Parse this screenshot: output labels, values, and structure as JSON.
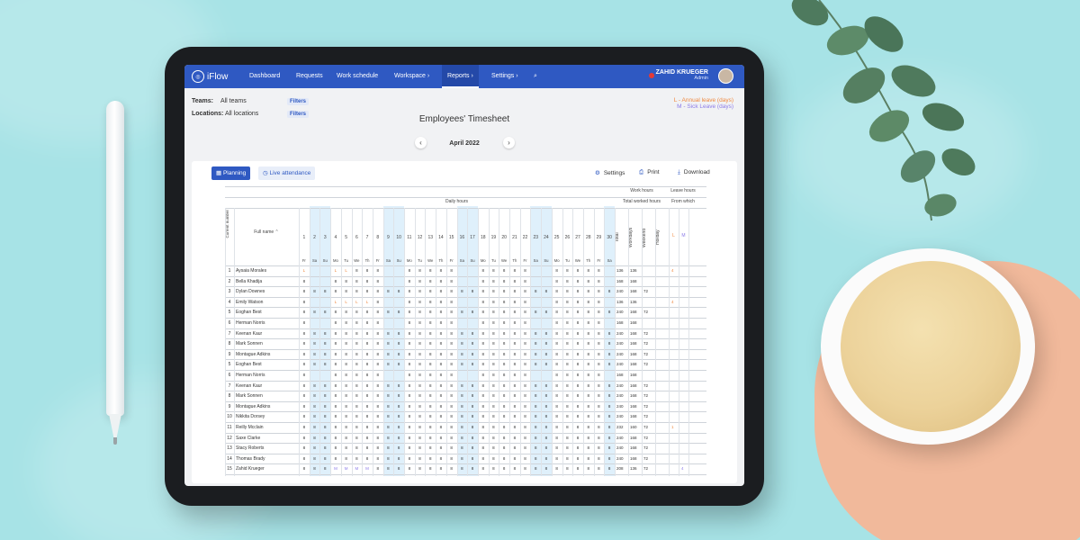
{
  "app": {
    "name": "iFlow",
    "nav": [
      "Dashboard",
      "Requests",
      "Work schedule",
      "Workspace",
      "Reports",
      "Settings"
    ],
    "nav_has_chevron": [
      false,
      false,
      false,
      true,
      true,
      true
    ],
    "active_nav": "Reports",
    "user_name": "ZAHID KRUEGER",
    "user_role": "Admin"
  },
  "filters": {
    "teams_label": "Teams:",
    "teams_value": "All teams",
    "locations_label": "Locations:",
    "locations_value": "All locations",
    "filters_button": "Filters"
  },
  "legend": {
    "annual": "L - Annual leave (days)",
    "sick": "M - Sick Leave (days)",
    "annual_color": "#f0883e",
    "sick_color": "#8c7be8"
  },
  "page_title": "Employees' Timesheet",
  "month": "April 2022",
  "tabs": {
    "planning": "Planning",
    "live": "Live attendance"
  },
  "tools": {
    "settings": "Settings",
    "print": "Print",
    "download": "Download"
  },
  "table": {
    "header_current_number": "Current number",
    "header_full_name": "Full name",
    "header_daily_hours": "Daily hours",
    "header_work_hours": "Work hours",
    "header_total_worked": "Total worked hours",
    "header_leave_hours": "Leave hours",
    "header_from_which": "From which",
    "total_cols": [
      "Total",
      "Workdays",
      "Weekend",
      "Holiday"
    ],
    "leave_cols": [
      "L",
      "M"
    ],
    "days": [
      "1",
      "2",
      "3",
      "4",
      "5",
      "6",
      "7",
      "8",
      "9",
      "10",
      "11",
      "12",
      "13",
      "14",
      "15",
      "16",
      "17",
      "18",
      "19",
      "20",
      "21",
      "22",
      "23",
      "24",
      "25",
      "26",
      "27",
      "28",
      "29",
      "30"
    ],
    "weekdays": [
      "Fr",
      "Sa",
      "Su",
      "Mo",
      "Tu",
      "We",
      "Th",
      "Fr",
      "Sa",
      "Su",
      "Mo",
      "Tu",
      "We",
      "Th",
      "Fr",
      "Sa",
      "Su",
      "Mo",
      "Tu",
      "We",
      "Th",
      "Fr",
      "Sa",
      "Su",
      "Mo",
      "Tu",
      "We",
      "Th",
      "Fr",
      "Sa"
    ],
    "rows": [
      {
        "n": "1",
        "name": "Aysaia Morales",
        "total": "136",
        "work": "136",
        "weekend": "",
        "l": "4",
        "m": ""
      },
      {
        "n": "2",
        "name": "Bella Khadija",
        "total": "168",
        "work": "168",
        "weekend": "",
        "l": "",
        "m": ""
      },
      {
        "n": "3",
        "name": "Dylan Downes",
        "total": "240",
        "work": "168",
        "weekend": "72",
        "l": "",
        "m": ""
      },
      {
        "n": "4",
        "name": "Emily Watson",
        "total": "136",
        "work": "136",
        "weekend": "",
        "l": "4",
        "m": ""
      },
      {
        "n": "5",
        "name": "Eoghan Best",
        "total": "240",
        "work": "168",
        "weekend": "72",
        "l": "",
        "m": ""
      },
      {
        "n": "6",
        "name": "Herman Norris",
        "total": "168",
        "work": "168",
        "weekend": "",
        "l": "",
        "m": ""
      },
      {
        "n": "7",
        "name": "Keenan Kaur",
        "total": "240",
        "work": "168",
        "weekend": "72",
        "l": "",
        "m": ""
      },
      {
        "n": "8",
        "name": "Mark Sonnen",
        "total": "240",
        "work": "168",
        "weekend": "72",
        "l": "",
        "m": ""
      },
      {
        "n": "9",
        "name": "Montague Adkins",
        "total": "240",
        "work": "168",
        "weekend": "72",
        "l": "",
        "m": ""
      },
      {
        "n": "5",
        "name": "Eoghan Best",
        "total": "240",
        "work": "168",
        "weekend": "72",
        "l": "",
        "m": ""
      },
      {
        "n": "6",
        "name": "Herman Norris",
        "total": "168",
        "work": "168",
        "weekend": "",
        "l": "",
        "m": ""
      },
      {
        "n": "7",
        "name": "Keenan Kaur",
        "total": "240",
        "work": "168",
        "weekend": "72",
        "l": "",
        "m": ""
      },
      {
        "n": "8",
        "name": "Mark Sonnen",
        "total": "240",
        "work": "168",
        "weekend": "72",
        "l": "",
        "m": ""
      },
      {
        "n": "9",
        "name": "Montague Adkins",
        "total": "240",
        "work": "168",
        "weekend": "72",
        "l": "",
        "m": ""
      },
      {
        "n": "10",
        "name": "Nikkita Dorsey",
        "total": "240",
        "work": "168",
        "weekend": "72",
        "l": "",
        "m": ""
      },
      {
        "n": "11",
        "name": "Reilly Mcclain",
        "total": "232",
        "work": "160",
        "weekend": "72",
        "l": "1",
        "m": ""
      },
      {
        "n": "12",
        "name": "Saxe Clarke",
        "total": "240",
        "work": "168",
        "weekend": "72",
        "l": "",
        "m": ""
      },
      {
        "n": "13",
        "name": "Stacy Roberts",
        "total": "240",
        "work": "168",
        "weekend": "72",
        "l": "",
        "m": ""
      },
      {
        "n": "14",
        "name": "Thomas Brady",
        "total": "240",
        "work": "168",
        "weekend": "72",
        "l": "",
        "m": ""
      },
      {
        "n": "15",
        "name": "Zahid Krueger",
        "total": "208",
        "work": "136",
        "weekend": "72",
        "l": "",
        "m": "4"
      }
    ],
    "cell_value": "8",
    "annual_mark": "L",
    "sick_mark": "M"
  }
}
